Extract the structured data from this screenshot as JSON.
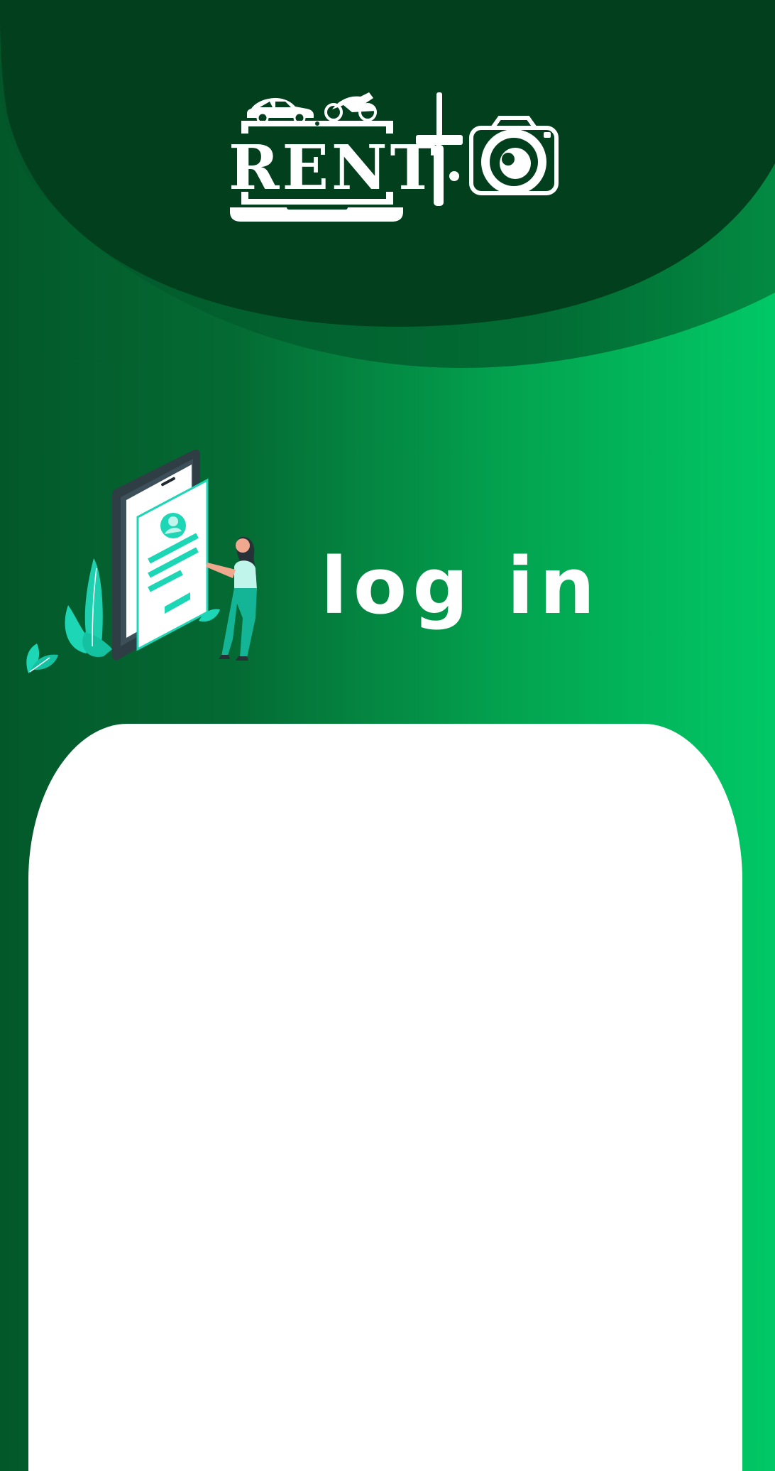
{
  "header": {
    "logo_text": "RENT",
    "logo_icon": "camera-icon",
    "vehicle_icons": [
      "car-icon",
      "motorcycle-icon"
    ],
    "tool_icon": "screwdriver-icon"
  },
  "hero": {
    "title": "log in",
    "illustration": "phone-login-illustration"
  },
  "colors": {
    "background_dark": "#03582a",
    "background_light": "#01c866",
    "header_dark": "#013f1d",
    "accent_teal": "#1cd6b5",
    "card": "#ffffff"
  }
}
